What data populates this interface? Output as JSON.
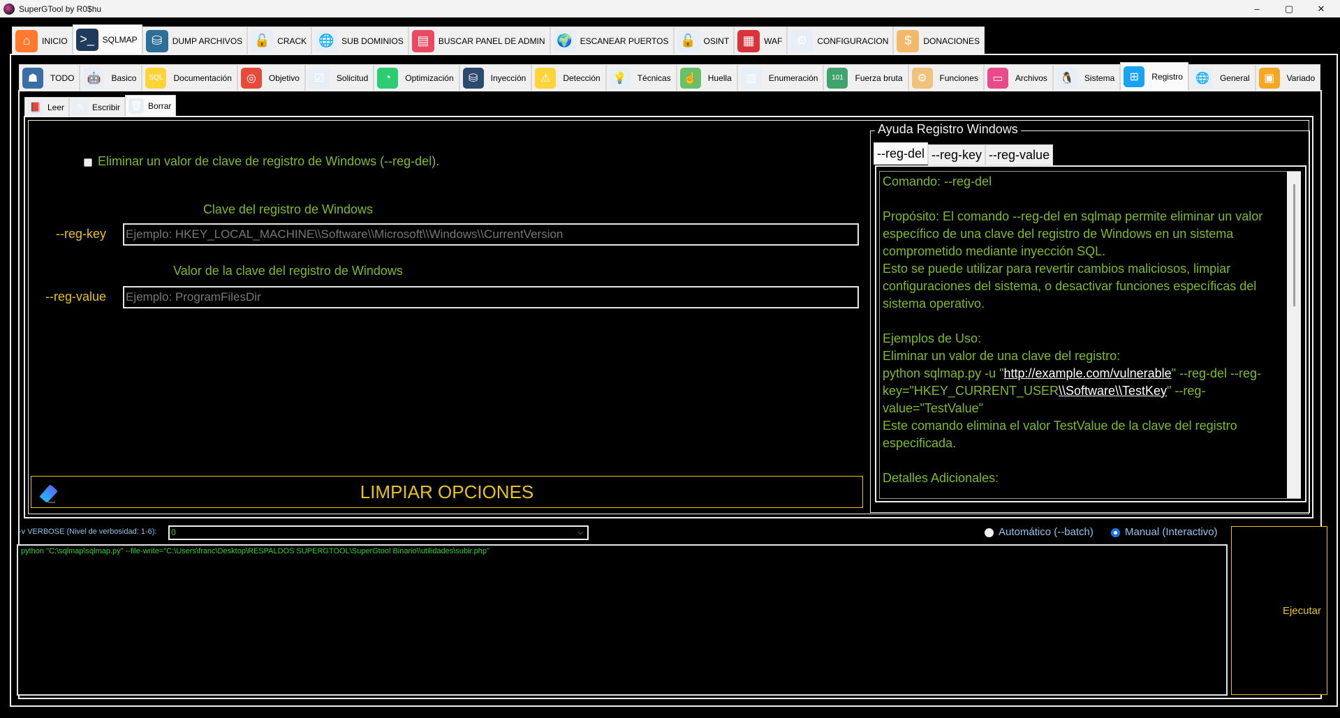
{
  "window": {
    "title": "SuperGTool by R0$hu",
    "controls": {
      "minimize": "–",
      "maximize": "▢",
      "close": "✕"
    }
  },
  "main_tabs": [
    {
      "label": "INICIO",
      "icon": "home-icon",
      "glyph": "⌂",
      "color": "#ff7a2f",
      "active": false
    },
    {
      "label": "SQLMAP",
      "icon": "terminal-icon",
      "glyph": ">_",
      "color": "#1f3a5a",
      "active": true
    },
    {
      "label": "DUMP ARCHIVOS",
      "icon": "database-download-icon",
      "glyph": "⛁",
      "color": "#2d6f96",
      "active": false
    },
    {
      "label": "CRACK",
      "icon": "password-lock-icon",
      "glyph": "🔓",
      "color": "#e8eef5",
      "active": false
    },
    {
      "label": "SUB DOMINIOS",
      "icon": "network-globe-icon",
      "glyph": "🌐",
      "color": "#e8eef5",
      "active": false
    },
    {
      "label": "BUSCAR PANEL DE ADMIN",
      "icon": "admin-panel-icon",
      "glyph": "▤",
      "color": "#e84a5f",
      "active": false
    },
    {
      "label": "ESCANEAR PUERTOS",
      "icon": "port-scan-globe-icon",
      "glyph": "🌍",
      "color": "#e8eef5",
      "active": false
    },
    {
      "label": "OSINT",
      "icon": "unlock-icon",
      "glyph": "🔓",
      "color": "#e8eef5",
      "active": false
    },
    {
      "label": "WAF",
      "icon": "firewall-icon",
      "glyph": "▦",
      "color": "#d9333a",
      "active": false
    },
    {
      "label": "CONFIGURACION",
      "icon": "gear-icon",
      "glyph": "⚙",
      "color": "#e8eef5",
      "active": false
    },
    {
      "label": "DONACIONES",
      "icon": "donate-box-icon",
      "glyph": "$",
      "color": "#f2b96b",
      "active": false
    }
  ],
  "sqlmap_tabs": [
    {
      "label": "TODO",
      "icon": "hacker-hood-icon",
      "glyph": "☗",
      "color": "#3a6ea5",
      "active": false
    },
    {
      "label": "Basico",
      "icon": "robot-icon",
      "glyph": "🤖",
      "color": "#e8eef5",
      "active": false
    },
    {
      "label": "Documentación",
      "icon": "sql-document-icon",
      "glyph": "SQL",
      "color": "#ffd43b",
      "active": false
    },
    {
      "label": "Objetivo",
      "icon": "target-icon",
      "glyph": "◎",
      "color": "#e84a3a",
      "active": false
    },
    {
      "label": "Solicitud",
      "icon": "request-form-icon",
      "glyph": "☑",
      "color": "#e8eef5",
      "active": false
    },
    {
      "label": "Optimización",
      "icon": "speed-gauge-icon",
      "glyph": "◔",
      "color": "#2ecc71",
      "active": false
    },
    {
      "label": "Inyección",
      "icon": "database-syringe-icon",
      "glyph": "⛁",
      "color": "#2b4a6e",
      "active": false
    },
    {
      "label": "Detección",
      "icon": "warning-magnifier-icon",
      "glyph": "⚠",
      "color": "#ffd43b",
      "active": false
    },
    {
      "label": "Técnicas",
      "icon": "idea-gear-icon",
      "glyph": "💡",
      "color": "#e8eef5",
      "active": false
    },
    {
      "label": "Huella",
      "icon": "fingerprint-icon",
      "glyph": "☝",
      "color": "#6abf69",
      "active": false
    },
    {
      "label": "Enumeración",
      "icon": "server-person-icon",
      "glyph": "▥",
      "color": "#e8eef5",
      "active": false
    },
    {
      "label": "Fuerza bruta",
      "icon": "binary-code-icon",
      "glyph": "101",
      "color": "#3fa36b",
      "active": false
    },
    {
      "label": "Funciones",
      "icon": "head-gear-icon",
      "glyph": "⚙",
      "color": "#f2c27b",
      "active": false
    },
    {
      "label": "Archivos",
      "icon": "file-icon",
      "glyph": "▭",
      "color": "#e84a8a",
      "active": false
    },
    {
      "label": "Sistema",
      "icon": "linux-penguin-icon",
      "glyph": "🐧",
      "color": "#e8eef5",
      "active": false
    },
    {
      "label": "Registro",
      "icon": "windows-logo-icon",
      "glyph": "⊞",
      "color": "#1aa3f0",
      "active": true
    },
    {
      "label": "General",
      "icon": "globe-cycle-icon",
      "glyph": "🌐",
      "color": "#e8eef5",
      "active": false
    },
    {
      "label": "Variado",
      "icon": "toolbox-icon",
      "glyph": "▣",
      "color": "#f5a623",
      "active": false
    }
  ],
  "registry_tabs": [
    {
      "label": "Leer",
      "icon": "reading-book-icon",
      "glyph": "📕",
      "color": "#e8eef5",
      "active": false
    },
    {
      "label": "Escribir",
      "icon": "writing-pencil-icon",
      "glyph": "✎",
      "color": "#e8eef5",
      "active": false
    },
    {
      "label": "Borrar",
      "icon": "trash-icon",
      "glyph": "🗑",
      "color": "#e8eef5",
      "active": true
    }
  ],
  "form": {
    "reg_del_checkbox": {
      "label": "Eliminar un valor de clave de registro de Windows (--reg-del).",
      "checked": false
    },
    "reg_key": {
      "title": "Clave del registro de Windows",
      "option": "--reg-key",
      "value": "",
      "placeholder": "Ejemplo: HKEY_LOCAL_MACHINE\\\\Software\\\\Microsoft\\\\Windows\\\\CurrentVersion"
    },
    "reg_value": {
      "title": "Valor de la clave del registro de Windows",
      "option": "--reg-value",
      "value": "",
      "placeholder": "Ejemplo: ProgramFilesDir"
    },
    "clear_button": "LIMPIAR OPCIONES"
  },
  "help": {
    "title": "Ayuda Registro Windows",
    "tabs": [
      {
        "label": "--reg-del",
        "active": true
      },
      {
        "label": "--reg-key",
        "active": false
      },
      {
        "label": "--reg-value",
        "active": false
      }
    ],
    "lines": {
      "command": "Comando: --reg-del",
      "purpose_1": "Propósito: El comando --reg-del en sqlmap permite eliminar un valor específico de una clave del registro de Windows en un sistema comprometido mediante inyección SQL.",
      "purpose_2": "Esto se puede utilizar para revertir cambios maliciosos, limpiar configuraciones del sistema, o desactivar funciones específicas del sistema operativo.",
      "examples_title": "Ejemplos de Uso:",
      "example_desc": "Eliminar un valor de una clave del registro:",
      "example_cmd_pre": "python sqlmap.py -u \"",
      "example_url": "http://example.com/vulnerable",
      "example_cmd_mid": "\" --reg-del --reg-key=\"HKEY_CURRENT_USER",
      "example_path": "\\\\Software\\\\TestKey",
      "example_cmd_post": "\" --reg-value=\"TestValue\"",
      "example_result": "Este comando elimina el valor TestValue de la clave del registro especificada.",
      "details_title": "Detalles Adicionales:"
    },
    "scroll_position": 0
  },
  "bottom": {
    "verbose_label": "-v VERBOSE (Nivel de verbosidad: 1-6):",
    "verbose_value": "0",
    "mode_options": [
      {
        "label": "Automático (--batch)",
        "checked": false
      },
      {
        "label": "Manual (Interactivo)",
        "checked": true
      }
    ],
    "command": "python \"C:\\sqlmap\\sqlmap.py\" --file-write=\"C:\\Users\\franc\\Desktop\\RESPALDOS SUPERGTOOL\\SuperGtool Binario\\\\utilidades\\subir.php\"",
    "execute_button": "Ejecutar"
  },
  "colors": {
    "option_text": "#7dbb28",
    "option_flag": "#e8c21a",
    "command_text": "#28d428",
    "info_text": "#8ec5f0",
    "radio_accent": "#1a73e8"
  }
}
